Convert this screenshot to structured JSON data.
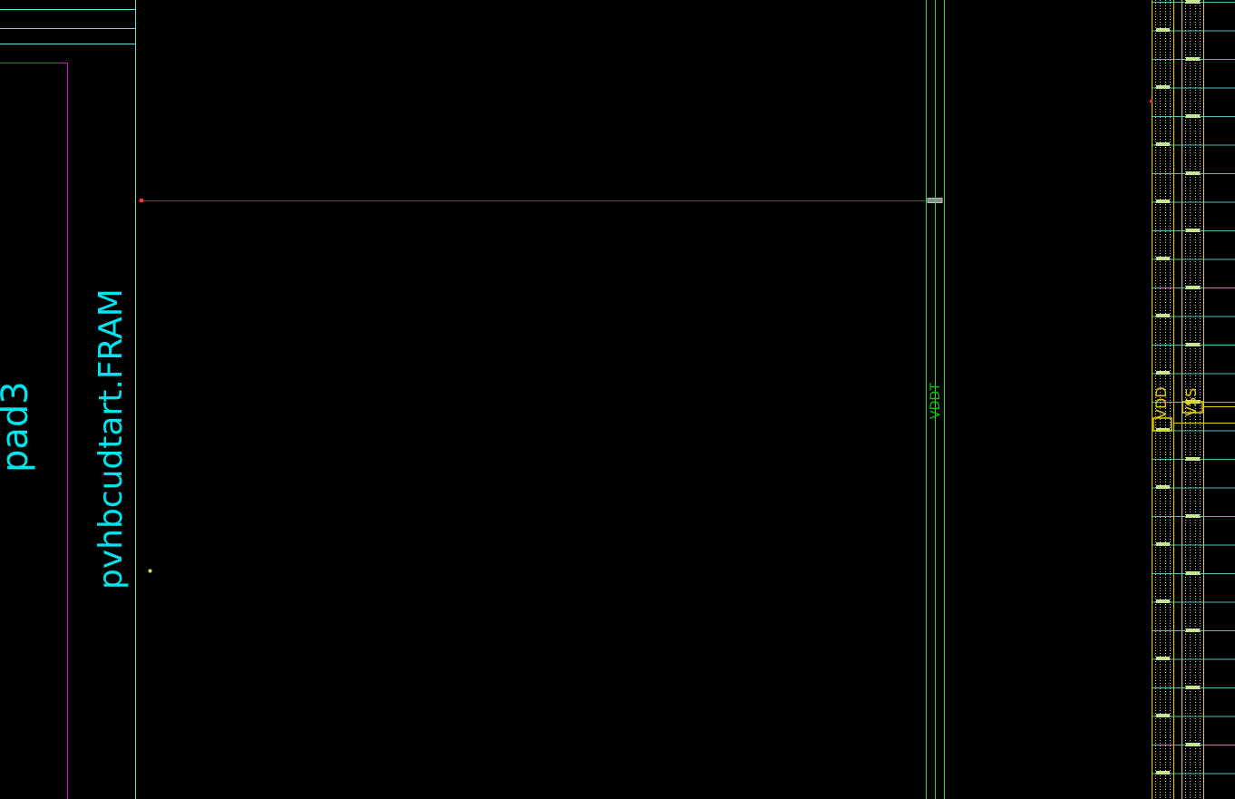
{
  "layout_view": {
    "background": "#000000",
    "colors": {
      "boundary": "#5fe3dd",
      "pad_outline": "#c020c0",
      "route": "#e01010",
      "pin": "#ff3030",
      "power_strap": "#33dd33",
      "rail": "#e6d200",
      "rail_dots": "#c8c8a0",
      "via": "#c8e890",
      "text_cyan": "#00e5ee"
    },
    "labels": {
      "pad_name": "pad3",
      "cell_name": "pvhbcudtart.FRAM",
      "strap_net": "VDDT",
      "rail_vdd": "VDD",
      "rail_vss": "VSS"
    }
  }
}
